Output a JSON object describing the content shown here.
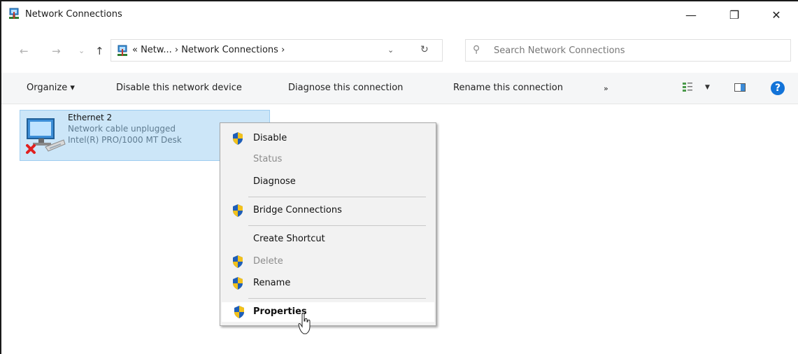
{
  "window": {
    "title": "Network Connections",
    "minimize_glyph": "—",
    "maximize_glyph": "❐",
    "close_glyph": "✕"
  },
  "navigation": {
    "back_glyph": "←",
    "forward_glyph": "→",
    "recent_glyph": "⌄",
    "up_glyph": "↑",
    "address_path": "« Netw...  ›  Network Connections  ›",
    "address_dropdown_glyph": "⌄",
    "refresh_glyph": "↻"
  },
  "search": {
    "icon_glyph": "⚲",
    "placeholder": "Search Network Connections"
  },
  "commandbar": {
    "organize": "Organize ▾",
    "disable": "Disable this network device",
    "diagnose": "Diagnose this connection",
    "rename": "Rename this connection",
    "more": "»",
    "view_caret": "▼",
    "help": "?"
  },
  "connection": {
    "name": "Ethernet 2",
    "status": "Network cable unplugged",
    "adapter": "Intel(R) PRO/1000 MT Desk",
    "status_icon": "red-x-icon"
  },
  "context_menu": {
    "items": [
      {
        "label": "Disable",
        "shield": true,
        "enabled": true
      },
      {
        "label": "Status",
        "shield": false,
        "enabled": false
      },
      {
        "label": "Diagnose",
        "shield": false,
        "enabled": true
      },
      {
        "label": "Bridge Connections",
        "shield": true,
        "enabled": true
      },
      {
        "label": "Create Shortcut",
        "shield": false,
        "enabled": true
      },
      {
        "label": "Delete",
        "shield": true,
        "enabled": false
      },
      {
        "label": "Rename",
        "shield": true,
        "enabled": true
      },
      {
        "label": "Properties",
        "shield": true,
        "enabled": true,
        "default": true
      }
    ]
  },
  "colors": {
    "selection": "#cce6f8",
    "accent": "#1273d8",
    "shield_blue": "#1f5fb8",
    "shield_yellow": "#f2c11b"
  }
}
